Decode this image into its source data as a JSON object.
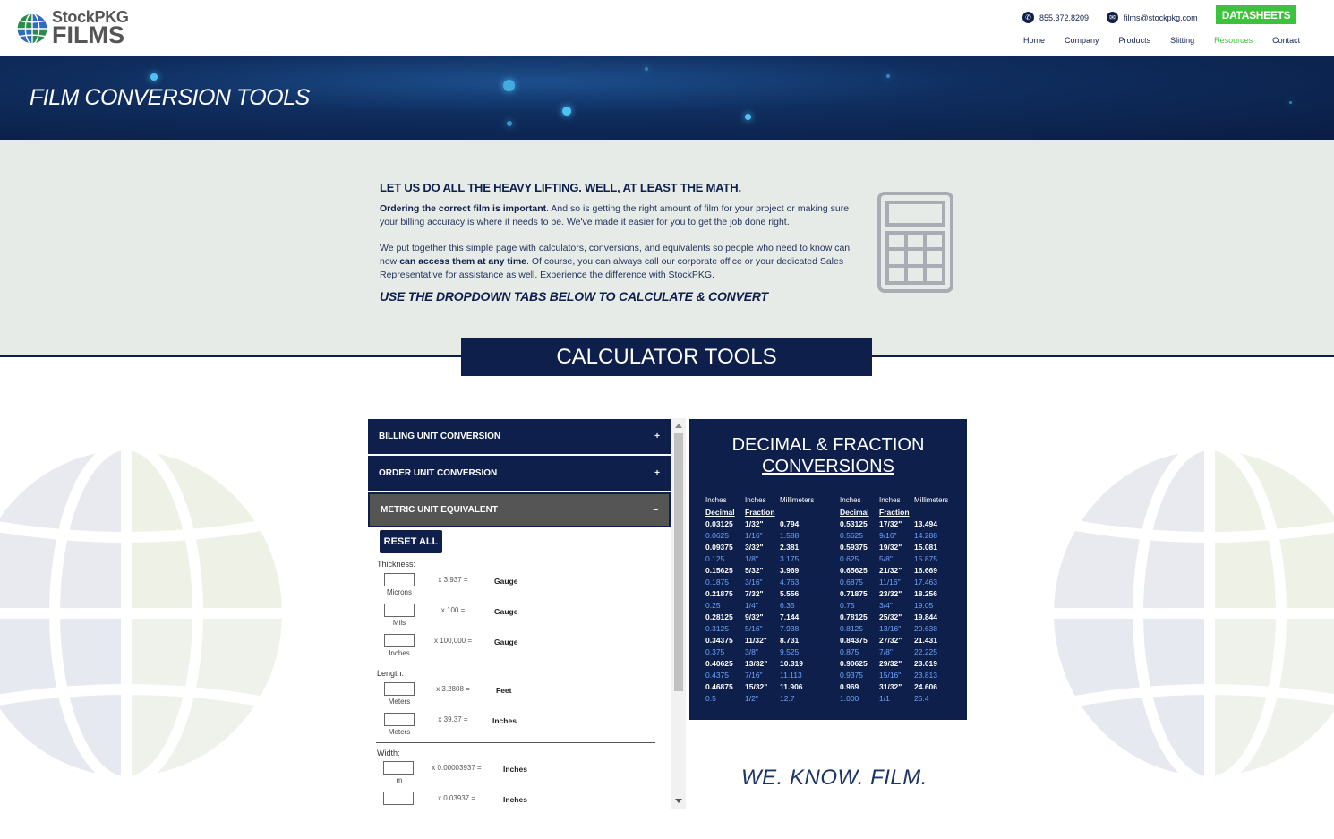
{
  "header": {
    "logo_brand": "StockPKG",
    "logo_films": "FILMS",
    "phone": "855.372.8209",
    "email": "films@stockpkg.com",
    "datasheets_label": "DATASHEETS",
    "nav": [
      "Home",
      "Company",
      "Products",
      "Slitting",
      "Resources",
      "Contact"
    ],
    "active_nav": "Resources",
    "accent_color": "#3bc43b"
  },
  "banner": {
    "title": "FILM CONVERSION TOOLS"
  },
  "intro": {
    "heading": "LET US DO ALL THE HEAVY LIFTING.  WELL, AT LEAST THE MATH.",
    "p1_bold": "Ordering the correct film is important",
    "p1_rest": ". And so is getting the right amount of film for your project or making sure your billing accuracy is where it needs to be. We've made it easier for you to get the job done right.",
    "p2_a": "We put together this simple page with calculators, conversions, and equivalents so people who need to know can now ",
    "p2_bold": "can access them at any time",
    "p2_b": ". Of course, you can always call our corporate office or your dedicated Sales Representative for assistance as well. Experience the difference with StockPKG.",
    "cta": "USE THE DROPDOWN TABS BELOW TO CALCULATE & CONVERT",
    "icon": "calculator-icon"
  },
  "section_title": "CALCULATOR TOOLS",
  "accordion": {
    "items": [
      {
        "label": "BILLING UNIT CONVERSION",
        "sign": "+"
      },
      {
        "label": "ORDER UNIT CONVERSION",
        "sign": "+"
      },
      {
        "label": "METRIC UNIT EQUIVALENT",
        "sign": "–"
      }
    ],
    "reset_label": "RESET ALL",
    "thickness_label": "Thickness:",
    "thickness_rows": [
      {
        "unit": "Microns",
        "factor": "x 3.937 =",
        "result": "Gauge"
      },
      {
        "unit": "Mils",
        "factor": "x 100 =",
        "result": "Gauge"
      },
      {
        "unit": "Inches",
        "factor": "x 100,000 =",
        "result": "Gauge"
      }
    ],
    "length_label": "Length:",
    "length_rows": [
      {
        "unit": "Meters",
        "factor": "x 3.2808 =",
        "result": "Feet"
      },
      {
        "unit": "Meters",
        "factor": "x 39.37 =",
        "result": "Inches"
      }
    ],
    "width_label": "Width:",
    "width_rows": [
      {
        "unit": "m",
        "factor": "x 0.00003937 =",
        "result": "Inches"
      },
      {
        "unit": "",
        "factor": "x 0.03937 =",
        "result": "Inches"
      }
    ]
  },
  "decimal_panel": {
    "title_line1": "DECIMAL & FRACTION",
    "title_line2": "CONVERSIONS",
    "head": [
      "Inches",
      "Inches",
      "Millimeters"
    ],
    "sub": [
      "Decimal",
      "Fraction",
      ""
    ],
    "left": [
      [
        "0.03125",
        "1/32\"",
        "0.794"
      ],
      [
        "0.0625",
        "1/16\"",
        "1.588"
      ],
      [
        "0.09375",
        "3/32\"",
        "2.381"
      ],
      [
        "0.125",
        "1/8\"",
        "3.175"
      ],
      [
        "0.15625",
        "5/32\"",
        "3.969"
      ],
      [
        "0.1875",
        "3/16\"",
        "4.763"
      ],
      [
        "0.21875",
        "7/32\"",
        "5.556"
      ],
      [
        "0.25",
        "1/4\"",
        "6.35"
      ],
      [
        "0.28125",
        "9/32\"",
        "7.144"
      ],
      [
        "0.3125",
        "5/16\"",
        "7.938"
      ],
      [
        "0.34375",
        "11/32\"",
        "8.731"
      ],
      [
        "0.375",
        "3/8\"",
        "9.525"
      ],
      [
        "0.40625",
        "13/32\"",
        "10.319"
      ],
      [
        "0.4375",
        "7/16\"",
        "11.113"
      ],
      [
        "0.46875",
        "15/32\"",
        "11.906"
      ],
      [
        "0.5",
        "1/2\"",
        "12.7"
      ]
    ],
    "right": [
      [
        "0.53125",
        "17/32\"",
        "13.494"
      ],
      [
        "0.5625",
        "9/16\"",
        "14.288"
      ],
      [
        "0.59375",
        "19/32\"",
        "15.081"
      ],
      [
        "0.625",
        "5/8\"",
        "15.875"
      ],
      [
        "0.65625",
        "21/32\"",
        "16.669"
      ],
      [
        "0.6875",
        "11/16\"",
        "17.463"
      ],
      [
        "0.71875",
        "23/32\"",
        "18.256"
      ],
      [
        "0.75",
        "3/4\"",
        "19.05"
      ],
      [
        "0.78125",
        "25/32\"",
        "19.844"
      ],
      [
        "0.8125",
        "13/16\"",
        "20.638"
      ],
      [
        "0.84375",
        "27/32\"",
        "21.431"
      ],
      [
        "0.875",
        "7/8\"",
        "22.225"
      ],
      [
        "0.90625",
        "29/32\"",
        "23.019"
      ],
      [
        "0.9375",
        "15/16\"",
        "23.813"
      ],
      [
        "0.969",
        "31/32\"",
        "24.606"
      ],
      [
        "1.000",
        "1/1",
        "25.4"
      ]
    ]
  },
  "tagline": "WE. KNOW. FILM."
}
